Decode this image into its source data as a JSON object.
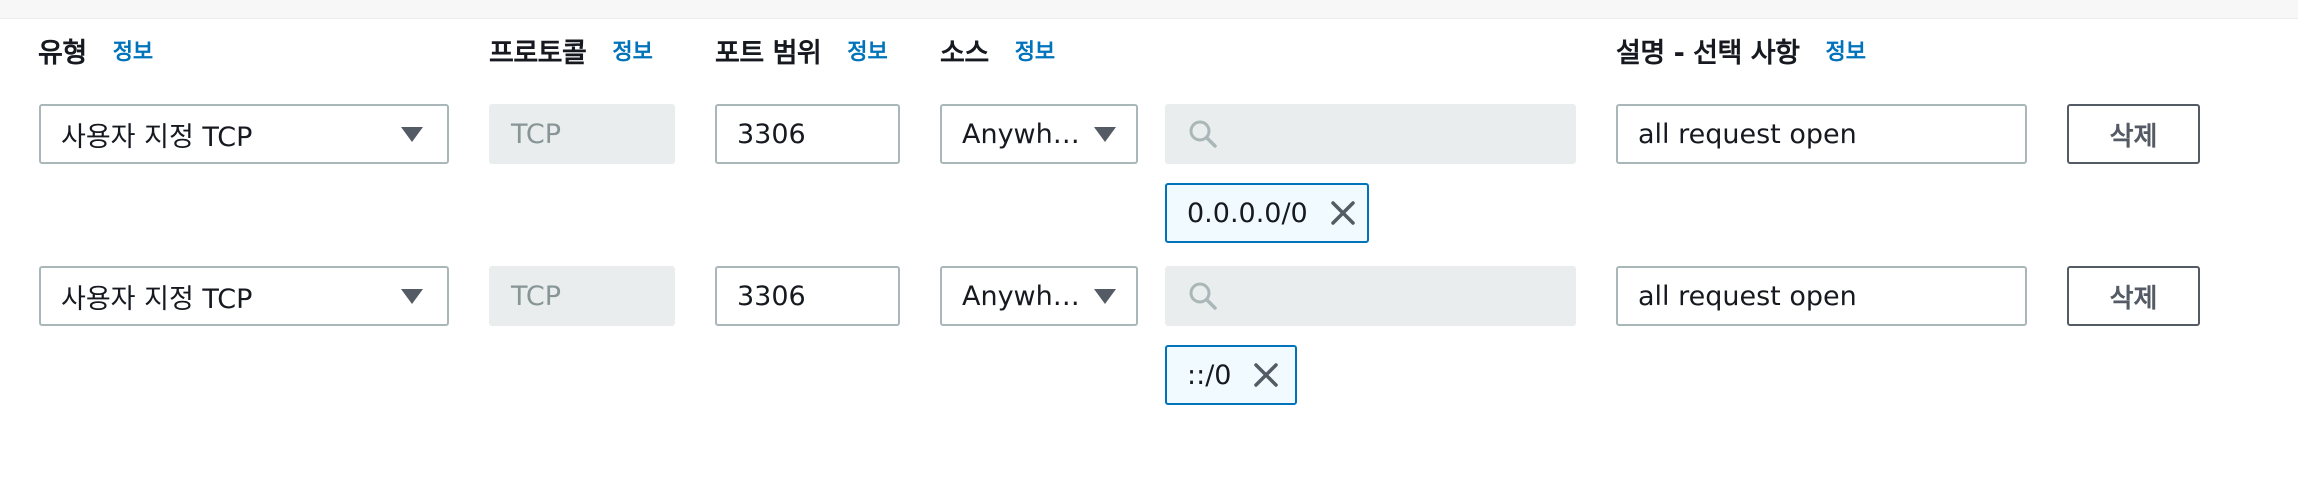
{
  "headers": {
    "type": "유형",
    "protocol": "프로토콜",
    "port_range": "포트 범위",
    "source": "소스",
    "description": "설명 - 선택 사항",
    "info": "정보"
  },
  "rules": [
    {
      "type": "사용자 지정 TCP",
      "protocol": "TCP",
      "port_range": "3306",
      "source": "Anywh…",
      "search_value": "",
      "cidr_token": "0.0.0.0/0",
      "description": "all request open",
      "delete_label": "삭제"
    },
    {
      "type": "사용자 지정 TCP",
      "protocol": "TCP",
      "port_range": "3306",
      "source": "Anywh…",
      "search_value": "",
      "cidr_token": "::/0",
      "description": "all request open",
      "delete_label": "삭제"
    }
  ],
  "icons": {
    "dropdown": "caret-down-icon",
    "search": "search-icon",
    "remove": "close-icon"
  },
  "colors": {
    "link": "#0073bb",
    "disabled_bg": "#eaeded",
    "border": "#aab7b8",
    "token_border": "#0073bb"
  }
}
